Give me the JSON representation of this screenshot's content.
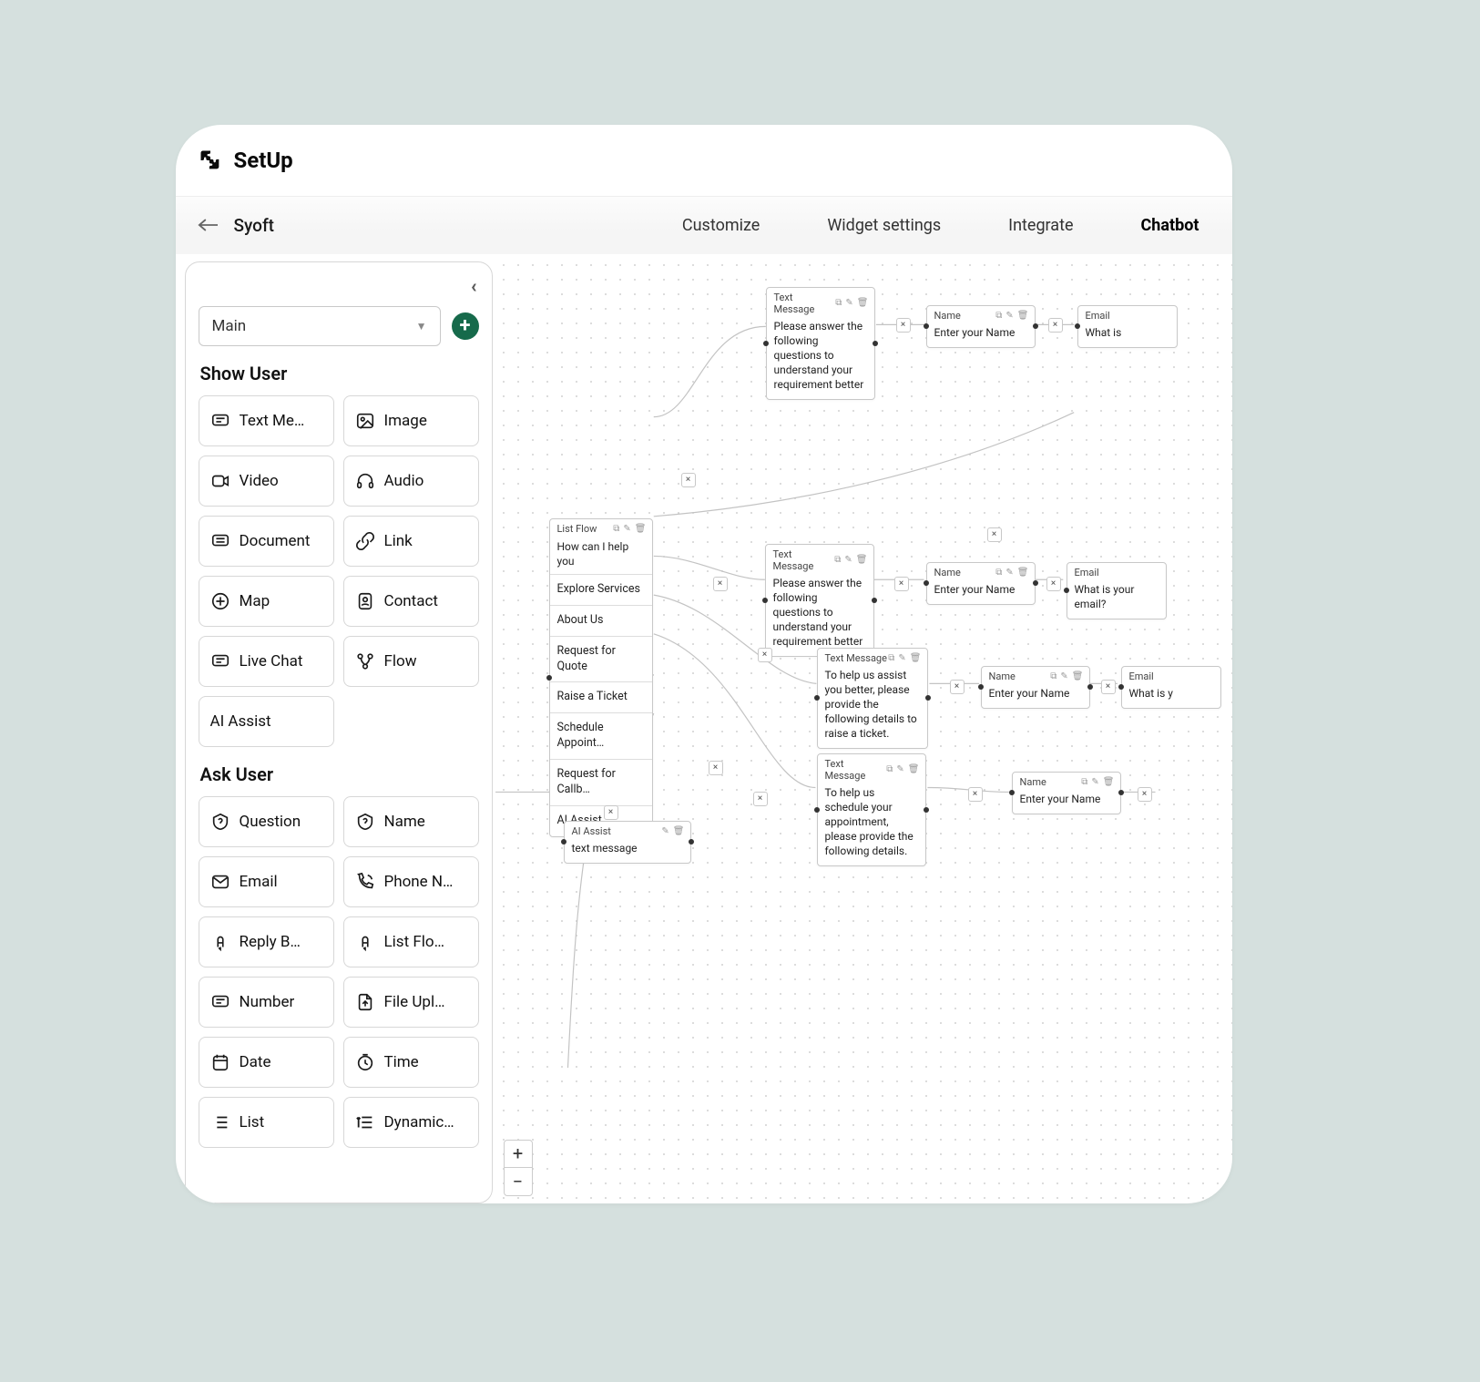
{
  "header": {
    "title": "SetUp"
  },
  "subheader": {
    "project": "Syoft",
    "tabs": [
      "Customize",
      "Widget settings",
      "Integrate",
      "Chatbot"
    ],
    "active_tab": "Chatbot"
  },
  "sidebar": {
    "flow_selected": "Main",
    "sections": [
      {
        "title": "Show User",
        "items": [
          "Text Me…",
          "Image",
          "Video",
          "Audio",
          "Document",
          "Link",
          "Map",
          "Contact",
          "Live Chat",
          "Flow",
          "AI Assist"
        ]
      },
      {
        "title": "Ask User",
        "items": [
          "Question",
          "Name",
          "Email",
          "Phone N…",
          "Reply B…",
          "List Flo…",
          "Number",
          "File Upl…",
          "Date",
          "Time",
          "List",
          "Dynamic…"
        ]
      }
    ]
  },
  "canvas": {
    "nodes": {
      "tm1": {
        "type": "Text Message",
        "body": "Please answer the following questions to understand your requirement better"
      },
      "name1": {
        "type": "Name",
        "body": "Enter your Name"
      },
      "email1": {
        "type": "Email",
        "body": "What is"
      },
      "lf": {
        "type": "List Flow",
        "title": "How can I help you",
        "options": [
          "Explore Services",
          "About Us",
          "Request for Quote",
          "Raise a Ticket",
          "Schedule Appoint…",
          "Request for Callb…",
          "AI Assist"
        ]
      },
      "tm2": {
        "type": "Text Message",
        "body": "Please answer the following questions to understand your requirement better"
      },
      "name2": {
        "type": "Name",
        "body": "Enter your Name"
      },
      "email2": {
        "type": "Email",
        "body": "What is your email?"
      },
      "tm3": {
        "type": "Text Message",
        "body": "To help us assist you better, please provide the following details to raise a ticket."
      },
      "name3": {
        "type": "Name",
        "body": "Enter your Name"
      },
      "email3": {
        "type": "Email",
        "body": "What is y"
      },
      "tm4": {
        "type": "Text Message",
        "body": "To help us schedule your appointment, please provide the following details."
      },
      "name4": {
        "type": "Name",
        "body": "Enter your Name"
      },
      "ai": {
        "type": "AI Assist",
        "body": "text message"
      }
    }
  },
  "icons": {
    "show": [
      "text",
      "image",
      "video",
      "audio",
      "document",
      "link",
      "map",
      "contact",
      "livechat",
      "flow",
      "ai"
    ],
    "ask": [
      "question",
      "name",
      "email",
      "phone",
      "reply",
      "listflow",
      "number",
      "file",
      "date",
      "time",
      "list",
      "dynamic"
    ]
  }
}
